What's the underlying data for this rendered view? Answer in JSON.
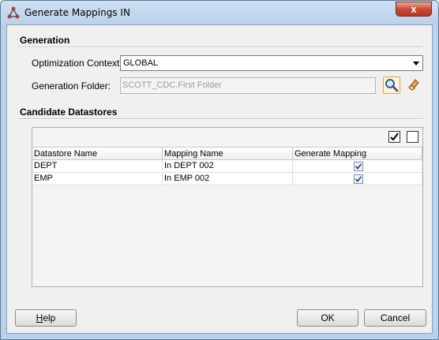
{
  "window": {
    "title": "Generate Mappings IN",
    "close_label": "x"
  },
  "generation": {
    "section_title": "Generation",
    "context_label": "Optimization Context:",
    "context_value": "GLOBAL",
    "folder_label": "Generation Folder:",
    "folder_value": "SCOTT_CDC.First Folder"
  },
  "candidates": {
    "section_title": "Candidate Datastores",
    "columns": [
      "Datastore Name",
      "Mapping Name",
      "Generate Mapping"
    ],
    "rows": [
      {
        "datastore": "DEPT",
        "mapping": "In DEPT 002",
        "generate": true
      },
      {
        "datastore": "EMP",
        "mapping": "In EMP 002",
        "generate": true
      }
    ]
  },
  "buttons": {
    "help_mnemonic": "H",
    "help_rest": "elp",
    "ok": "OK",
    "cancel": "Cancel"
  }
}
